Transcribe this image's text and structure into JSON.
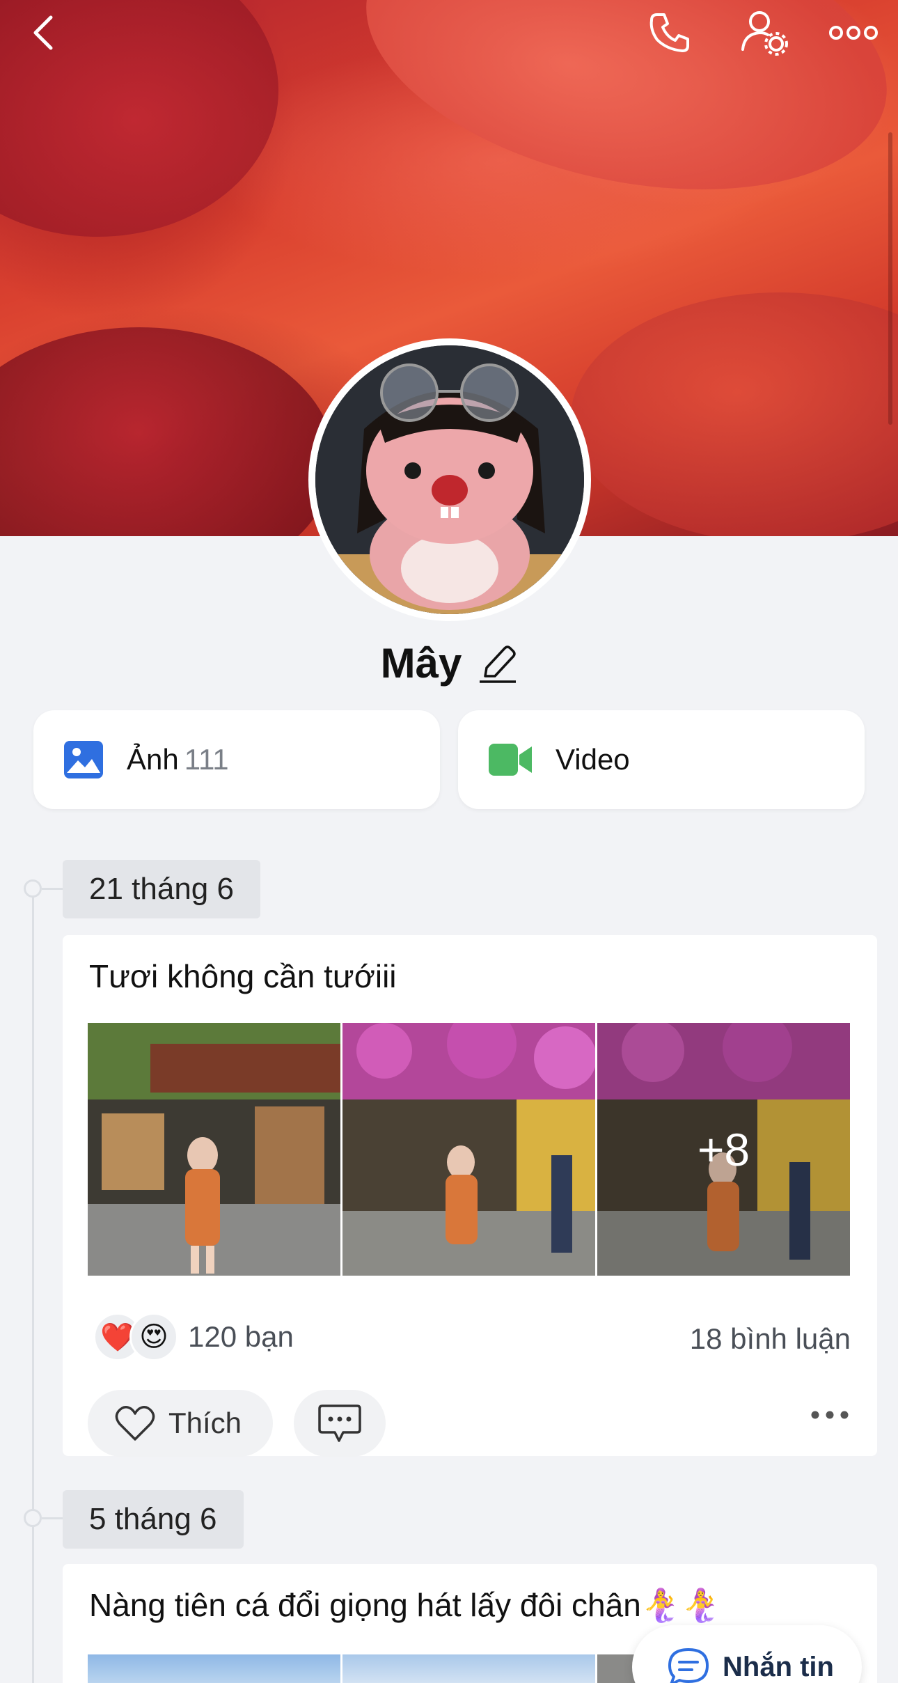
{
  "header": {
    "back_icon": "chevron-left-icon",
    "call_icon": "phone-icon",
    "settings_icon": "user-settings-icon",
    "more_icon": "more-horizontal-icon"
  },
  "profile": {
    "name": "Mây",
    "edit_icon": "pencil-icon"
  },
  "media": {
    "photos_label": "Ảnh",
    "photos_count": "111",
    "video_label": "Video"
  },
  "posts": [
    {
      "date": "21 tháng 6",
      "text": "Tươi không cần tướiii",
      "more_photos": "+8",
      "reactions": [
        "❤️",
        "😍"
      ],
      "reaction_count": "120 bạn",
      "comments": "18 bình luận",
      "like_label": "Thích"
    },
    {
      "date": "5 tháng 6",
      "text": "Nàng tiên cá đổi giọng hát lấy đôi chân🧜‍♀️🧜‍♀️"
    }
  ],
  "message_button": {
    "label": "Nhắn tin"
  },
  "colors": {
    "accent_blue": "#2f6fe0",
    "video_green": "#4cb963",
    "background": "#f2f3f6"
  }
}
